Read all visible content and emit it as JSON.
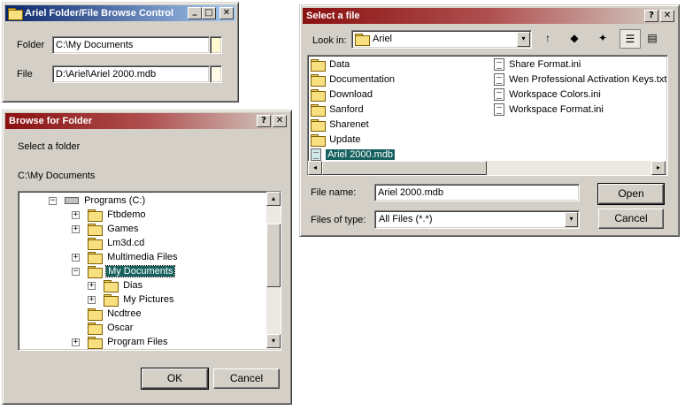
{
  "control": {
    "title": "Ariel Folder/File Browse Control",
    "folder_label": "Folder",
    "folder_value": "C:\\My Documents",
    "file_label": "File",
    "file_value": "D:\\Ariel\\Ariel 2000.mdb"
  },
  "browse": {
    "title": "Browse for Folder",
    "prompt": "Select a folder",
    "current_path": "C:\\My Documents",
    "tree": [
      {
        "label": "Programs (C:)",
        "expander": "−"
      },
      {
        "label": "Ftbdemo",
        "expander": "+"
      },
      {
        "label": "Games",
        "expander": "+"
      },
      {
        "label": "Lm3d.cd",
        "expander": ""
      },
      {
        "label": "Multimedia Files",
        "expander": "+"
      },
      {
        "label": "My Documents",
        "expander": "−"
      },
      {
        "label": "Dias",
        "expander": "+"
      },
      {
        "label": "My Pictures",
        "expander": "+"
      },
      {
        "label": "Ncdtree",
        "expander": ""
      },
      {
        "label": "Oscar",
        "expander": ""
      },
      {
        "label": "Program Files",
        "expander": "+"
      }
    ],
    "ok_label": "OK",
    "cancel_label": "Cancel"
  },
  "selectfile": {
    "title": "Select a file",
    "lookin_label": "Look in:",
    "lookin_value": "Ariel",
    "folders": [
      "Data",
      "Documentation",
      "Download",
      "Sanford",
      "Sharenet",
      "Update"
    ],
    "selected_file": "Ariel 2000.mdb",
    "files_col2": [
      "Share Format.ini",
      "Wen Professional Activation Keys.txt",
      "Workspace Colors.ini",
      "Workspace Format.ini"
    ],
    "filename_label": "File name:",
    "filename_value": "Ariel 2000.mdb",
    "filetype_label": "Files of type:",
    "filetype_value": "All Files (*.*)",
    "open_label": "Open",
    "cancel_label": "Cancel"
  },
  "glyphs": {
    "help": "?",
    "close": "✕",
    "minimize": "_",
    "maximize": "□",
    "dropdown": "▾",
    "up": "▴",
    "down": "▾",
    "left": "◂",
    "right": "▸"
  }
}
